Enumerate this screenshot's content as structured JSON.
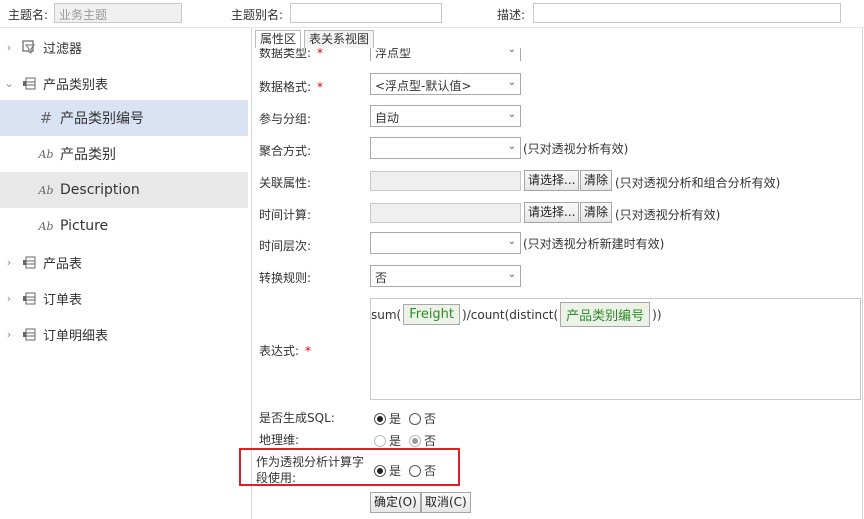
{
  "topbar": {
    "theme_name_label": "主题名:",
    "theme_name_value": "业务主题",
    "alias_label": "主题别名:",
    "alias_value": "",
    "desc_label": "描述:",
    "desc_value": ""
  },
  "tree": {
    "nodes": [
      {
        "label": "过滤器"
      },
      {
        "label": "产品类别表"
      },
      {
        "label": "产品类别编号"
      },
      {
        "label": "产品类别"
      },
      {
        "label": "Description"
      },
      {
        "label": "Picture"
      },
      {
        "label": "产品表"
      },
      {
        "label": "订单表"
      },
      {
        "label": "订单明细表"
      }
    ]
  },
  "tabs": {
    "props": "属性区",
    "relation": "表关系视图"
  },
  "form": {
    "data_type_label": "数据类型:",
    "data_type_value": "浮点型",
    "data_format_label": "数据格式:",
    "data_format_value": "<浮点型-默认值>",
    "group_label": "参与分组:",
    "group_value": "自动",
    "agg_label": "聚合方式:",
    "agg_value": "",
    "agg_hint": "(只对透视分析有效)",
    "rel_label": "关联属性:",
    "rel_hint": "(只对透视分析和组合分析有效)",
    "time_calc_label": "时间计算:",
    "time_calc_hint": "(只对透视分析有效)",
    "time_level_label": "时间层次:",
    "time_level_value": "",
    "time_level_hint": "(只对透视分析新建时有效)",
    "convert_label": "转换规则:",
    "convert_value": "否",
    "select_btn": "请选择...",
    "clear_btn": "清除",
    "expr_label": "表达式:",
    "expr_prefix": "sum(",
    "expr_chip1": "Freight",
    "expr_mid": ")/count(distinct(",
    "expr_chip2": "产品类别编号",
    "expr_suffix": "))",
    "sql_label": "是否生成SQL:",
    "geo_label": "地理维:",
    "calc_label_line1": "作为透视分析计算字",
    "calc_label_line2": "段使用:",
    "yes": "是",
    "no": "否",
    "ok_btn": "确定(O)",
    "cancel_btn": "取消(C)"
  }
}
